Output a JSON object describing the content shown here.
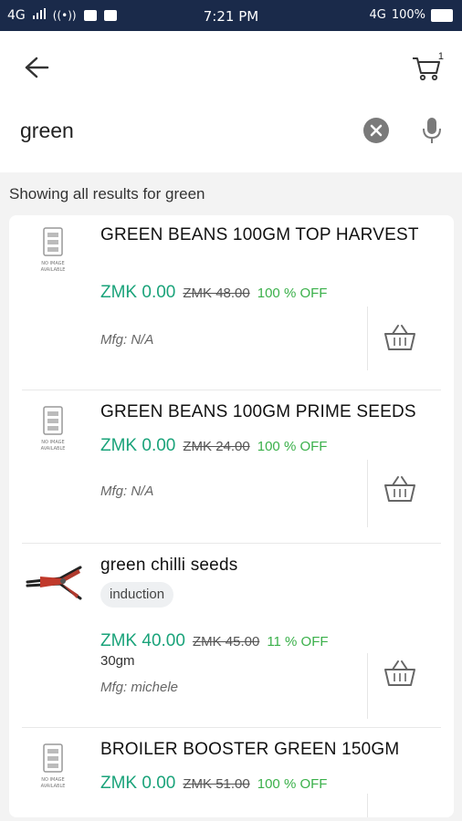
{
  "statusbar": {
    "network": "4G",
    "time": "7:21 PM",
    "network_right": "4G",
    "battery": "100%"
  },
  "header": {
    "cart_count": "1"
  },
  "search": {
    "query": "green"
  },
  "results": {
    "label": "Showing all results for green"
  },
  "products": [
    {
      "name": "GREEN BEANS 100GM TOP HARVEST",
      "price": "ZMK 0.00",
      "mrp": "ZMK 48.00",
      "off": "100 % OFF",
      "mfg": "Mfg: N/A",
      "image": "no-image-placeholder"
    },
    {
      "name": "GREEN BEANS  100GM PRIME SEEDS",
      "price": "ZMK 0.00",
      "mrp": "ZMK 24.00",
      "off": "100 % OFF",
      "mfg": "Mfg: N/A",
      "image": "no-image-placeholder"
    },
    {
      "name": "green chilli seeds",
      "tag": "induction",
      "price": "ZMK 40.00",
      "mrp": "ZMK 45.00",
      "off": "11 % OFF",
      "qty": "30gm",
      "mfg": "Mfg: michele",
      "image": "tongs-photo"
    },
    {
      "name": "BROILER BOOSTER GREEN 150GM",
      "price": "ZMK 0.00",
      "mrp": "ZMK 51.00",
      "off": "100 % OFF",
      "image": "no-image-placeholder"
    }
  ],
  "colors": {
    "statusbar": "#1a2a4a",
    "price": "#1aa37a",
    "discount": "#3ab04a"
  }
}
